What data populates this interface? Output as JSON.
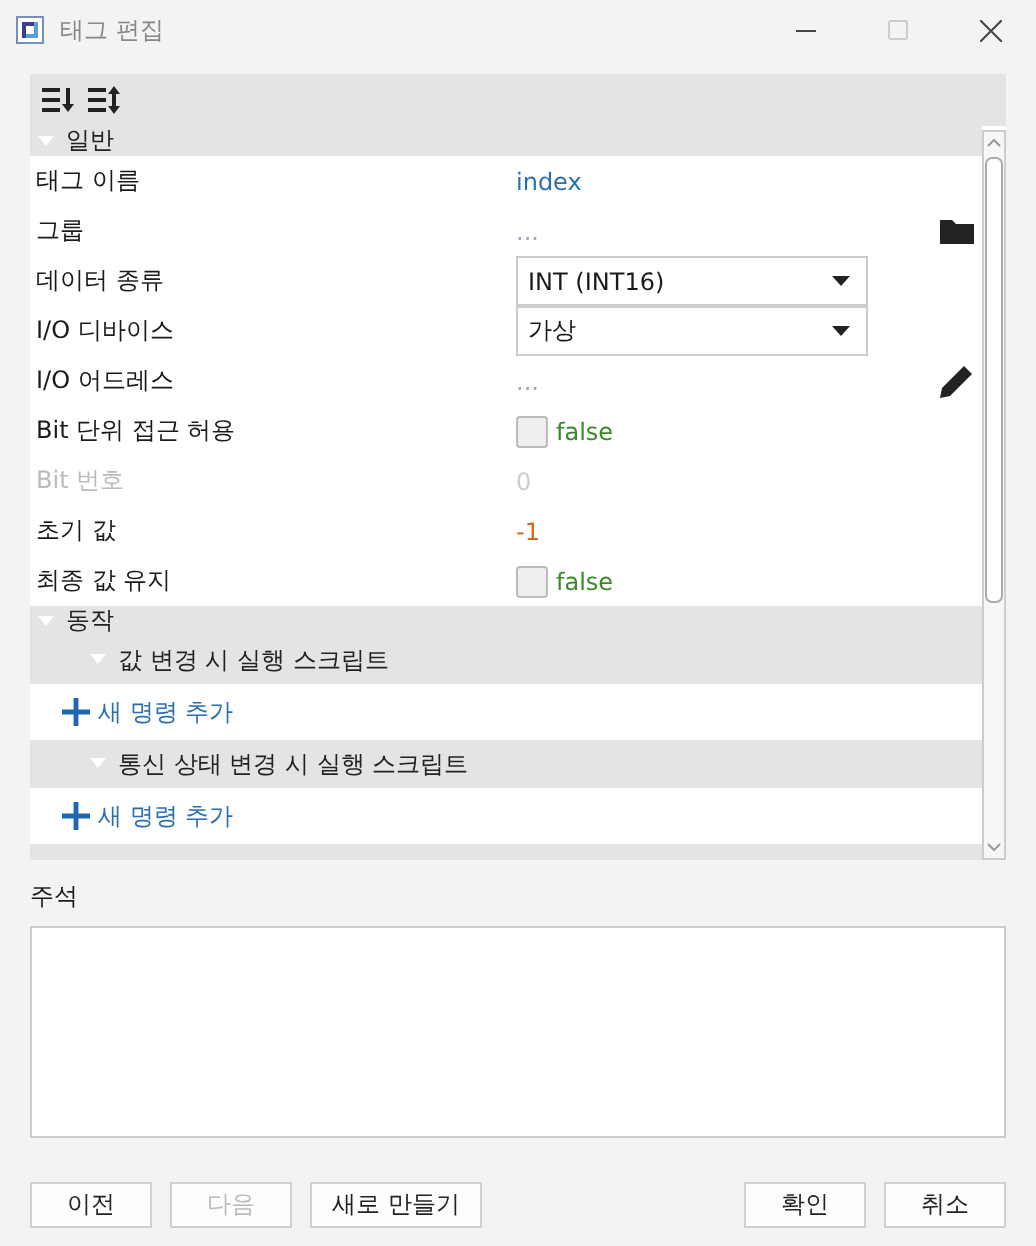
{
  "window": {
    "title": "태그 편집"
  },
  "sections": [
    {
      "kind": "properties",
      "title": "일반",
      "expanded": true,
      "rows": [
        {
          "kind": "plain",
          "label": "태그 이름",
          "disabled": false,
          "value": {
            "kind": "text",
            "text": "index",
            "color": "#2a6fb0"
          }
        },
        {
          "kind": "browse",
          "label": "그룹",
          "disabled": false,
          "value": {
            "kind": "ellipsis",
            "text": "..."
          }
        },
        {
          "kind": "plain",
          "label": "데이터 종류",
          "disabled": false,
          "value": {
            "kind": "combo",
            "text": "INT (INT16)"
          }
        },
        {
          "kind": "plain",
          "label": "I/O 디바이스",
          "disabled": false,
          "value": {
            "kind": "combo",
            "text": "가상"
          }
        },
        {
          "kind": "edit",
          "label": "I/O 어드레스",
          "disabled": false,
          "value": {
            "kind": "ellipsis",
            "text": "..."
          }
        },
        {
          "kind": "plain",
          "label": "Bit 단위 접근 허용",
          "disabled": false,
          "value": {
            "kind": "checkbox",
            "checked": false,
            "text": "false"
          }
        },
        {
          "kind": "plain",
          "label": "Bit 번호",
          "disabled": true,
          "value": {
            "kind": "text",
            "text": "0",
            "color": "#cccccc"
          }
        },
        {
          "kind": "plain",
          "label": "초기 값",
          "disabled": false,
          "value": {
            "kind": "text",
            "text": "-1",
            "color": "#d2691e"
          }
        },
        {
          "kind": "plain",
          "label": "최종 값 유지",
          "disabled": false,
          "value": {
            "kind": "checkbox",
            "checked": false,
            "text": "false"
          }
        }
      ]
    },
    {
      "kind": "scripts",
      "title": "동작",
      "expanded": true,
      "groups": [
        {
          "title": "값 변경 시 실행 스크립트",
          "expanded": true,
          "add_label": "새 명령 추가"
        },
        {
          "title": "통신 상태 변경 시 실행 스크립트",
          "expanded": true,
          "add_label": "새 명령 추가"
        }
      ]
    }
  ],
  "comment": {
    "label": "주석"
  },
  "left_buttons": [
    {
      "label": "이전",
      "disabled": false
    },
    {
      "label": "다음",
      "disabled": true
    },
    {
      "label": "새로 만들기",
      "disabled": false
    }
  ],
  "right_buttons": [
    {
      "label": "확인",
      "disabled": false
    },
    {
      "label": "취소",
      "disabled": false
    }
  ]
}
